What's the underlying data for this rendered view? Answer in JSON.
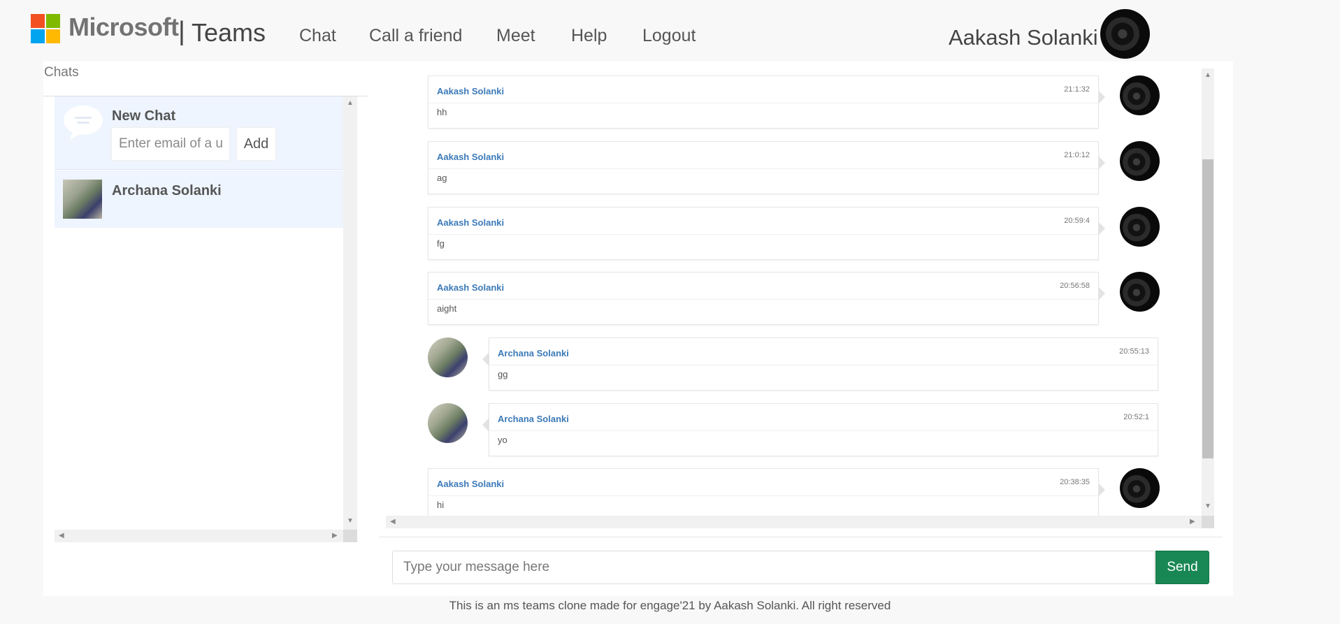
{
  "brand": {
    "company": "Microsoft",
    "separator": "|",
    "product": "Teams"
  },
  "nav": [
    {
      "label": "Chat"
    },
    {
      "label": "Call a friend"
    },
    {
      "label": "Meet"
    },
    {
      "label": "Help"
    },
    {
      "label": "Logout"
    }
  ],
  "user": {
    "name": "Aakash Solanki"
  },
  "sidebar": {
    "title": "Chats",
    "new_chat": {
      "title": "New Chat",
      "placeholder": "Enter email of a user",
      "add_label": "Add"
    },
    "contacts": [
      {
        "name": "Archana Solanki"
      }
    ]
  },
  "messages": [
    {
      "author": "Aakash Solanki",
      "time": "21:1:32",
      "text": "hh",
      "mine": true
    },
    {
      "author": "Aakash Solanki",
      "time": "21:0:12",
      "text": "ag",
      "mine": true
    },
    {
      "author": "Aakash Solanki",
      "time": "20:59:4",
      "text": "fg",
      "mine": true
    },
    {
      "author": "Aakash Solanki",
      "time": "20:56:58",
      "text": "aight",
      "mine": true
    },
    {
      "author": "Archana Solanki",
      "time": "20:55:13",
      "text": "gg",
      "mine": false
    },
    {
      "author": "Archana Solanki",
      "time": "20:52:1",
      "text": "yo",
      "mine": false
    },
    {
      "author": "Aakash Solanki",
      "time": "20:38:35",
      "text": "hi",
      "mine": true
    }
  ],
  "compose": {
    "placeholder": "Type your message here",
    "send_label": "Send"
  },
  "footer": {
    "text": "This is an ms teams clone made for engage'21 by Aakash Solanki. All right reserved"
  },
  "colors": {
    "accent_link": "#3c7ab8",
    "send_button": "#198754",
    "list_highlight": "#eef5ff"
  },
  "icons": [
    "microsoft-logo-icon",
    "chat-bubble-icon",
    "scroll-arrow-icon"
  ]
}
